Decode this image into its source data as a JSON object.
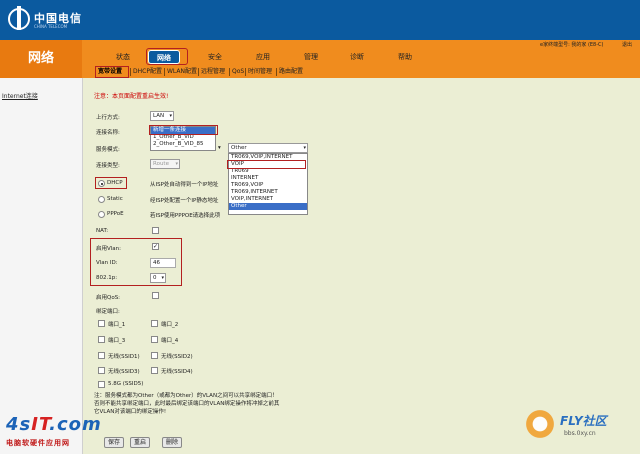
{
  "header": {
    "brand_name": "中国电信",
    "brand_sub": "CHINA TELECOM",
    "device_info": "e家终端型号: 我的家 (E8-C)",
    "help": "退出"
  },
  "section_title": "网络",
  "nav": [
    "状态",
    "网络",
    "安全",
    "应用",
    "管理",
    "诊断",
    "帮助"
  ],
  "nav_active": "网络",
  "subtabs": [
    "宽带设置",
    "DHCP配置",
    "WLAN配置",
    "远程管理",
    "QoS",
    "时间管理",
    "路由配置"
  ],
  "sidebar": {
    "item": "Internet连接"
  },
  "warning": "注意：本页面配置重启生效!",
  "form": {
    "upstream_label": "上行方式:",
    "upstream_value": "LAN",
    "conn_name_label": "连接名称:",
    "conn_name_options": [
      "新增一条连接",
      "1_Other_B_VID",
      "2_Other_B_VID_85"
    ],
    "service_mode_label": "服务模式:",
    "service_mode_value": "Other",
    "service_options": [
      "TR069,VOIP,INTERNET",
      "VOIP",
      "TR069",
      "INTERNET",
      "TR069,VOIP",
      "TR069,INTERNET",
      "VOIP,INTERNET",
      "Other"
    ],
    "conn_type_label": "连接类型:",
    "conn_type_value": "Route",
    "dhcp_label": "DHCP",
    "dhcp_desc": "从ISP处自动得到一个IP地址",
    "static_label": "Static",
    "static_desc": "经ISP处配置一个IP静态地址",
    "pppoe_label": "PPPoE",
    "pppoe_desc": "若ISP使用PPPOE请选择此项",
    "nat_label": "NAT:",
    "vlan_enable_label": "启用Vlan:",
    "vlan_id_label": "Vlan ID:",
    "vlan_id_value": "46",
    "dot1p_label": "802.1p:",
    "dot1p_value": "0",
    "qos_label": "启用QoS:",
    "bind_label": "绑定端口:",
    "ports": [
      "端口_1",
      "端口_2",
      "端口_3",
      "端口_4",
      "无线(SSID1)",
      "无线(SSID2)",
      "无线(SSID3)",
      "无线(SSID4)",
      "5.8G (SSID5)"
    ]
  },
  "note_lines": [
    "注：服务模式都为Other（或都为Other）的VLAN之间可以共享绑定端口！",
    "否则不能共享绑定端口，此时最后绑定该端口的VLAN绑定操作将冲掉之前其",
    "它VLAN对该端口的绑定操作!"
  ],
  "buttons": {
    "save": "保存",
    "reset": "重启",
    "delete": "删除"
  },
  "watermark_left": {
    "big_a": "4s",
    "big_b": "IT",
    "big_c": ".com",
    "small": "电脑软硬件应用网"
  },
  "watermark_right": {
    "brand": "FLY社区",
    "url": "bbs.0xy.cn"
  },
  "colors": {
    "header_blue": "#0b5a9f",
    "orange": "#f08c1e",
    "content_bg": "#ebeed4",
    "highlight_red": "#b32020",
    "list_selection": "#3a6ec7"
  }
}
